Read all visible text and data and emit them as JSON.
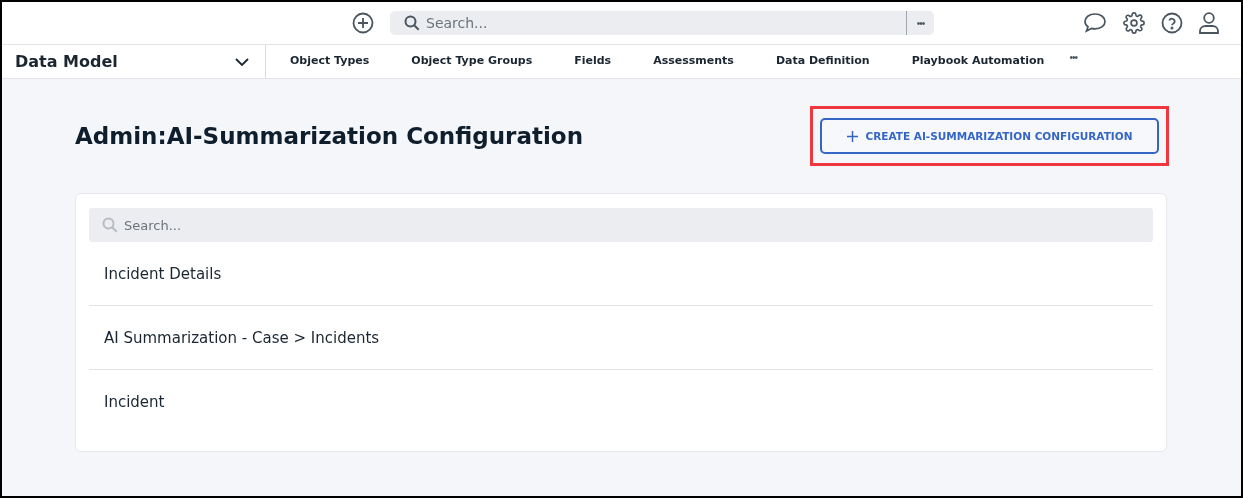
{
  "top_bar": {
    "search": {
      "placeholder": "Search..."
    },
    "more": "•••"
  },
  "nav": {
    "module": "Data Model",
    "tabs": [
      {
        "label": "Object Types",
        "selected": false
      },
      {
        "label": "Object Type Groups",
        "selected": false
      },
      {
        "label": "Fields",
        "selected": false
      },
      {
        "label": "Assessments",
        "selected": false
      },
      {
        "label": "Data Definition",
        "selected": false
      },
      {
        "label": "Playbook Automation",
        "selected": false
      }
    ],
    "more": "•••"
  },
  "page": {
    "title": "Admin:AI-Summarization Configuration",
    "create_button": {
      "label": "CREATE AI-SUMMARIZATION CONFIGURATION",
      "highlighted": true
    },
    "search": {
      "placeholder": "Search..."
    },
    "items": [
      "Incident Details",
      "AI Summarization - Case > Incidents",
      "Incident"
    ]
  }
}
